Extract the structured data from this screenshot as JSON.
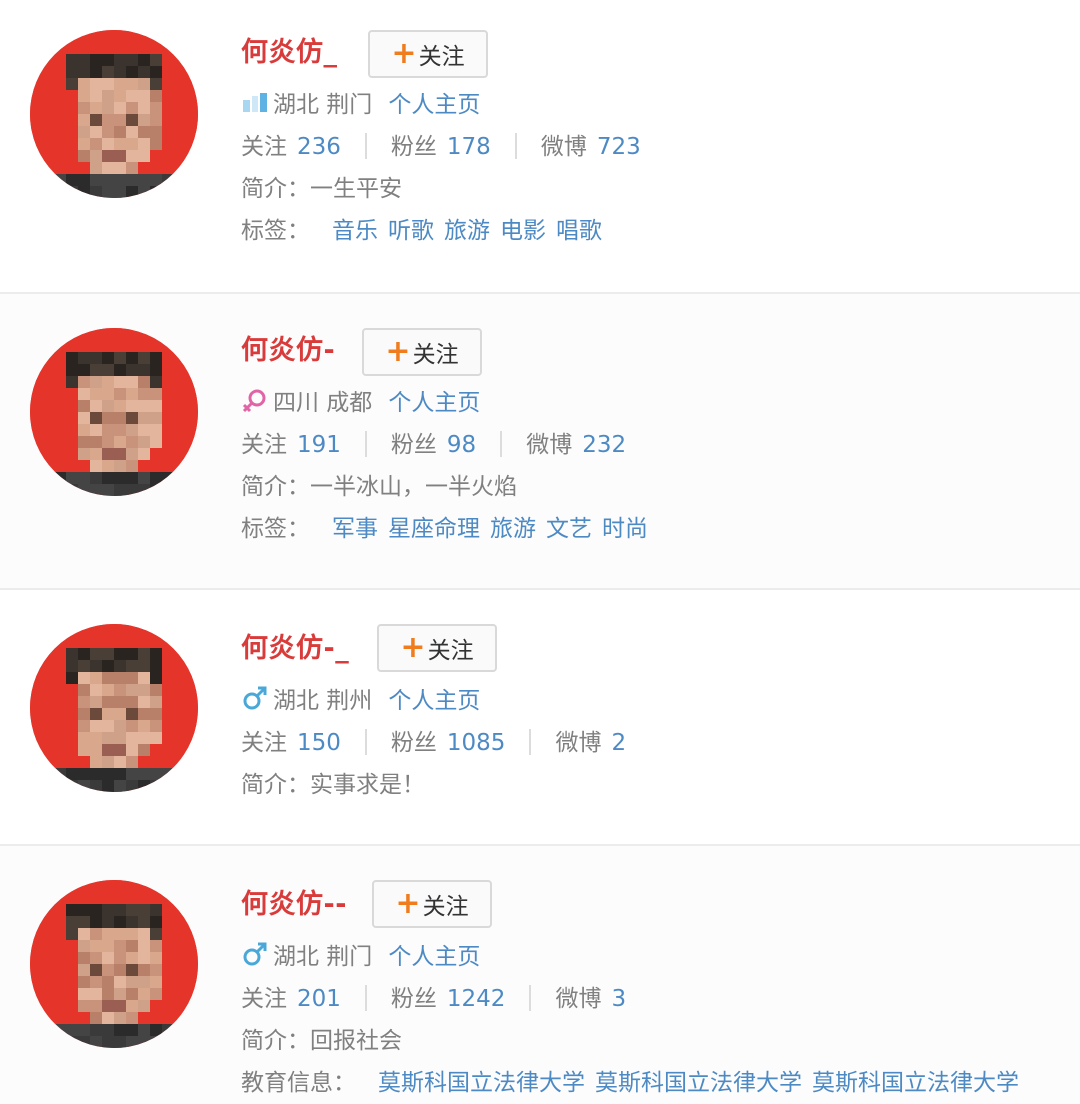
{
  "follow_label": "关注",
  "home_label": "个人主页",
  "stat_labels": {
    "following": "关注",
    "fans": "粉丝",
    "weibo": "微博"
  },
  "bio_label": "简介：",
  "tags_label": "标签：",
  "edu_label": "教育信息：",
  "colors": {
    "name": "#d93a3a",
    "link": "#4d8ac4",
    "plus": "#f07d1d",
    "avatar_bg": "#e5352b"
  },
  "users": [
    {
      "name": "何炎仿_",
      "gender_icon": "gender-unknown-icon",
      "location": "湖北 荆门",
      "following": "236",
      "fans": "178",
      "weibo": "723",
      "bio": "一生平安",
      "tags": [
        "音乐",
        "听歌",
        "旅游",
        "电影",
        "唱歌"
      ]
    },
    {
      "name": "何炎仿-",
      "gender_icon": "female-icon",
      "location": "四川 成都",
      "following": "191",
      "fans": "98",
      "weibo": "232",
      "bio": "一半冰山，一半火焰",
      "tags": [
        "军事",
        "星座命理",
        "旅游",
        "文艺",
        "时尚"
      ]
    },
    {
      "name": "何炎仿-_",
      "gender_icon": "male-icon",
      "location": "湖北 荆州",
      "following": "150",
      "fans": "1085",
      "weibo": "2",
      "bio": "实事求是！"
    },
    {
      "name": "何炎仿--",
      "gender_icon": "male-icon",
      "location": "湖北 荆门",
      "following": "201",
      "fans": "1242",
      "weibo": "3",
      "bio": "回报社会",
      "education": [
        "莫斯科国立法律大学",
        "莫斯科国立法律大学",
        "莫斯科国立法律大学"
      ]
    }
  ]
}
